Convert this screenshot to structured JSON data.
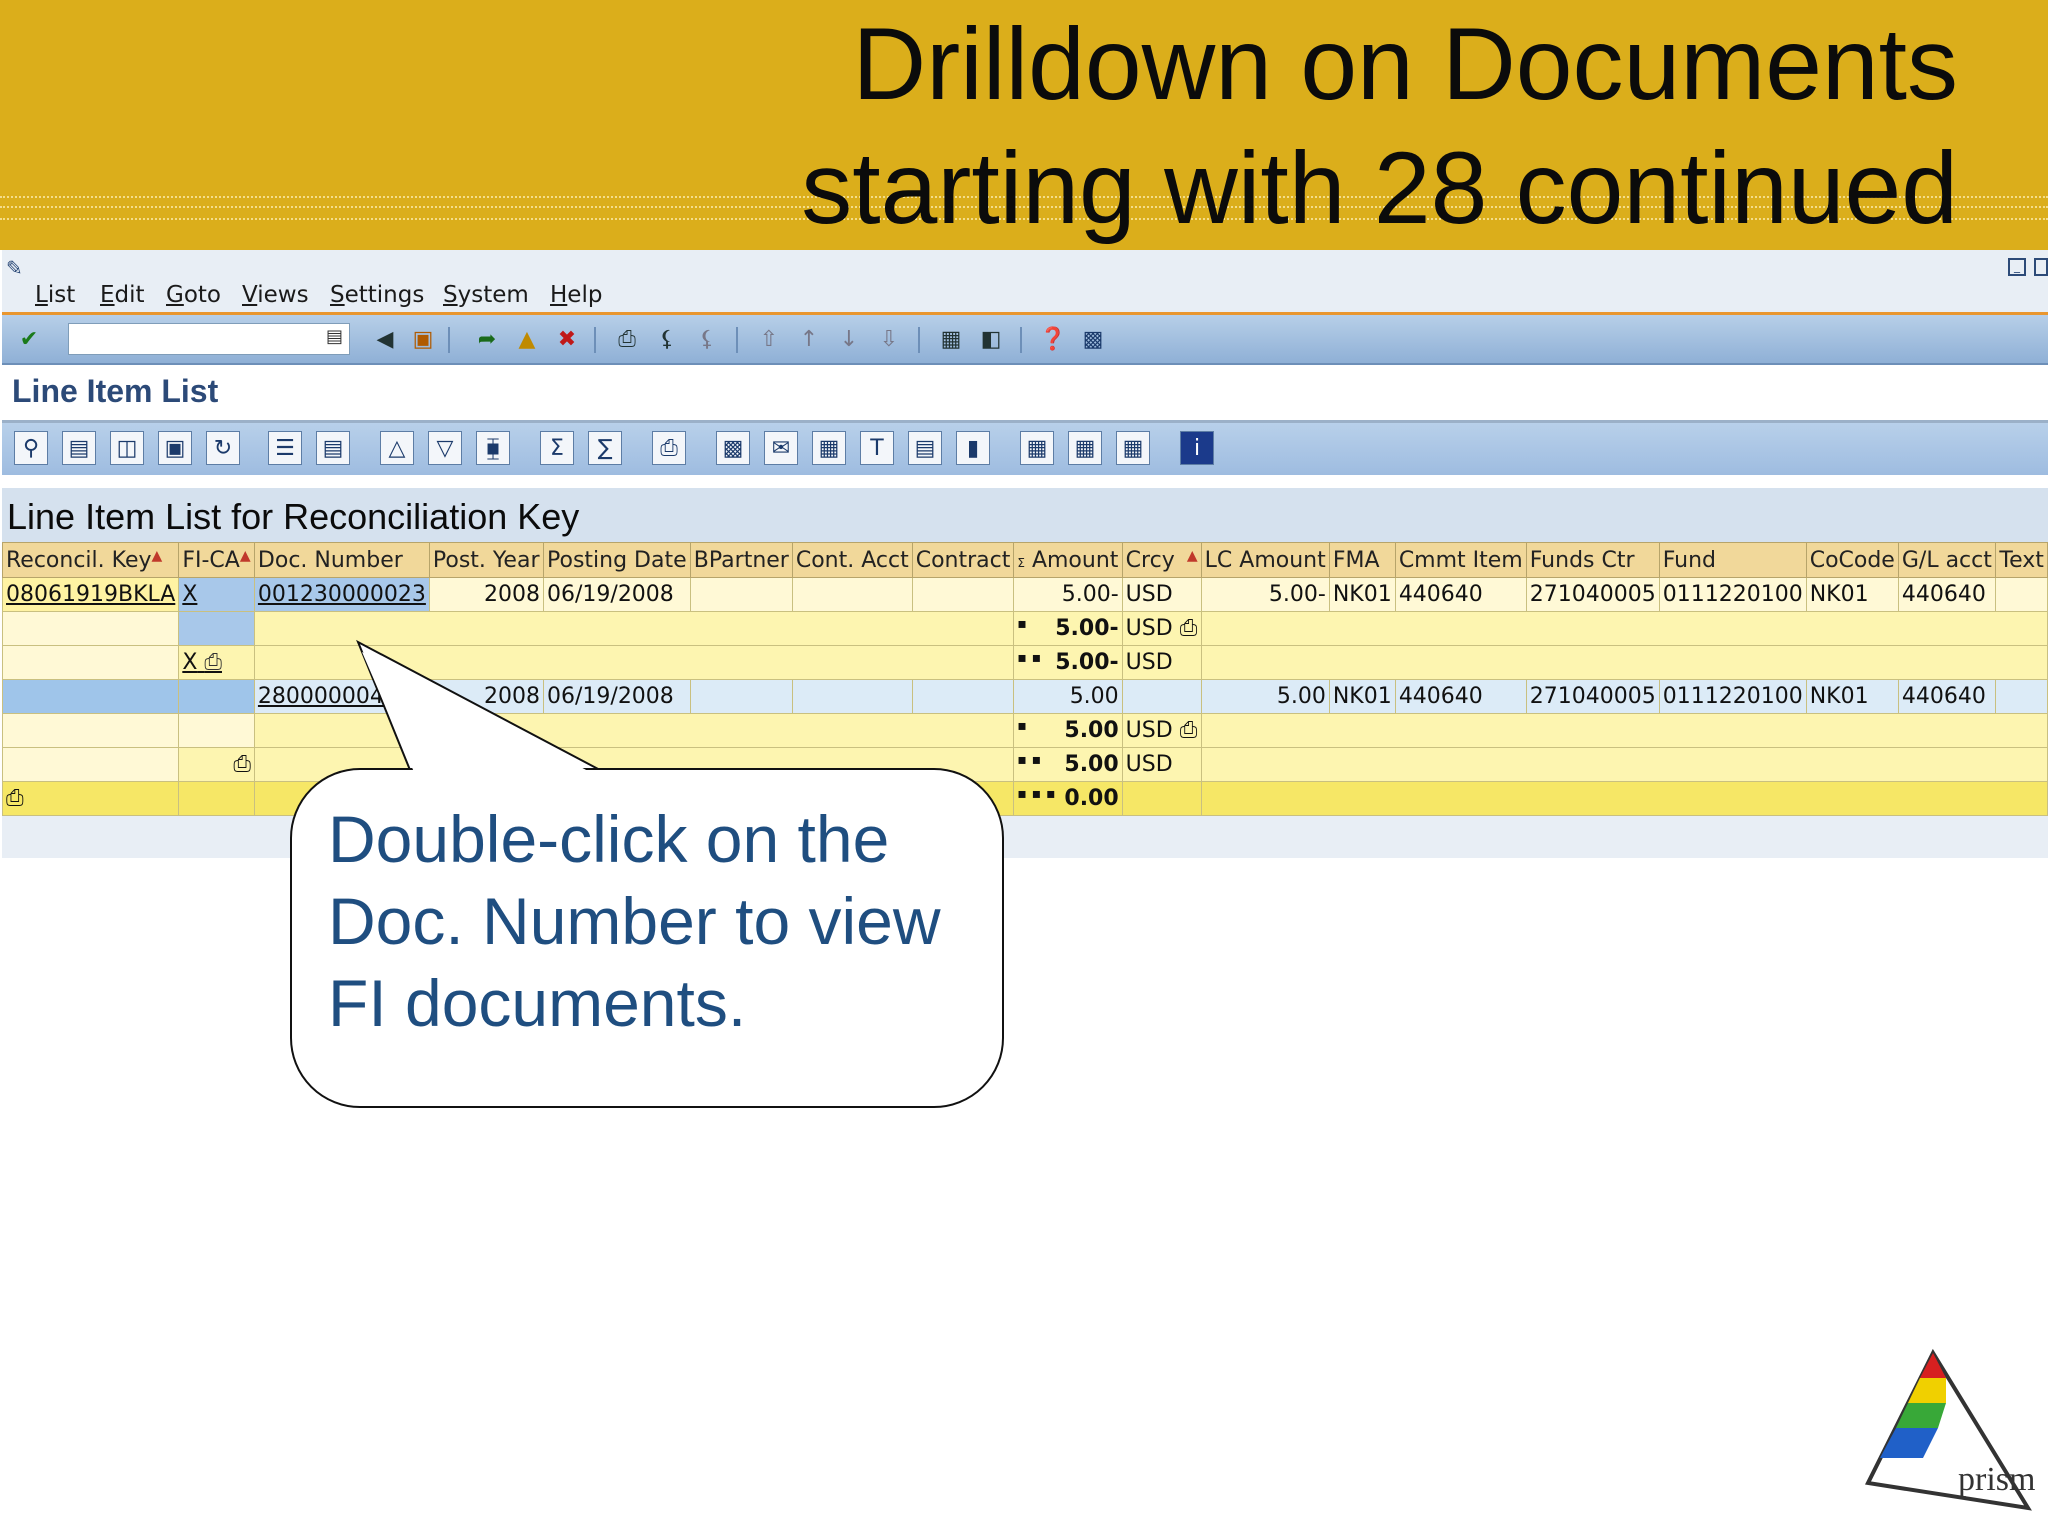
{
  "slide": {
    "title_line1": "Drilldown on Documents",
    "title_line2": "starting with 28 continued"
  },
  "menubar": {
    "items": [
      "List",
      "Edit",
      "Goto",
      "Views",
      "Settings",
      "System",
      "Help"
    ]
  },
  "screen": {
    "title": "Line Item List",
    "list_title": "Line Item List for Reconciliation Key"
  },
  "grid": {
    "columns": [
      "Reconcil. Key",
      "FI-CA",
      "Doc. Number",
      "Post. Year",
      "Posting Date",
      "BPartner",
      "Cont. Acct",
      "Contract",
      "Amount",
      "Crcy",
      "LC Amount",
      "FMA",
      "Cmmt Item",
      "Funds Ctr",
      "Fund",
      "CoCode",
      "G/L acct",
      "Text"
    ],
    "row1": {
      "reconcil_key": "08061919BKLA",
      "fica": "X",
      "doc_number": "001230000023",
      "post_year": "2008",
      "posting_date": "06/19/2008",
      "amount": "5.00-",
      "crcy": "USD",
      "lc_amount": "5.00-",
      "fma": "NK01",
      "cmmt_item": "440640",
      "funds_ctr": "271040005",
      "fund": "0111220100",
      "cocode": "NK01",
      "gl_acct": "440640"
    },
    "subtotal1": {
      "bullet": "▪",
      "amount": "5.00-",
      "crcy": "USD"
    },
    "subtotal2": {
      "fica": "X",
      "bullet": "▪ ▪",
      "amount": "5.00-",
      "crcy": "USD"
    },
    "row2": {
      "doc_number": "2800000040",
      "post_year": "2008",
      "posting_date": "06/19/2008",
      "amount": "5.00",
      "lc_amount": "5.00",
      "fma": "NK01",
      "cmmt_item": "440640",
      "funds_ctr": "271040005",
      "fund": "0111220100",
      "cocode": "NK01",
      "gl_acct": "440640"
    },
    "subtotal3": {
      "bullet": "▪",
      "amount": "5.00",
      "crcy": "USD"
    },
    "subtotal4": {
      "bullet": "▪ ▪",
      "amount": "5.00",
      "crcy": "USD"
    },
    "total": {
      "bullet": "▪ ▪ ▪",
      "amount": "0.00"
    }
  },
  "callout": {
    "text": "Double-click on the Doc. Number to view FI documents."
  },
  "logo": {
    "text": "prism"
  },
  "colors": {
    "banner": "#dbae1b",
    "callout_text": "#1f4e80",
    "sap_title": "#2c4a78"
  }
}
